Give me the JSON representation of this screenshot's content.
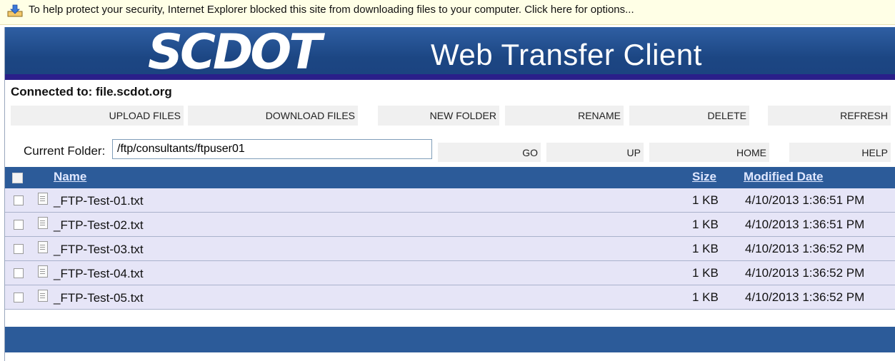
{
  "infobar": {
    "message": "To help protect your security, Internet Explorer blocked this site from downloading files to your computer. Click here for options..."
  },
  "banner": {
    "logo_text": "SCDOT",
    "title": "Web Transfer Client"
  },
  "connection": {
    "label": "Connected to: file.scdot.org"
  },
  "toolbar": {
    "upload": "UPLOAD FILES",
    "download": "DOWNLOAD FILES",
    "new_folder": "NEW FOLDER",
    "rename": "RENAME",
    "delete": "DELETE",
    "refresh": "REFRESH"
  },
  "folder": {
    "label": "Current Folder:",
    "value": "/ftp/consultants/ftpuser01",
    "go": "GO",
    "up": "UP",
    "home": "HOME",
    "help": "HELP"
  },
  "grid": {
    "headers": {
      "name": "Name",
      "size": "Size",
      "date": "Modified Date"
    },
    "rows": [
      {
        "name": "_FTP-Test-01.txt",
        "size": "1 KB",
        "date": "4/10/2013 1:36:51 PM"
      },
      {
        "name": "_FTP-Test-02.txt",
        "size": "1 KB",
        "date": "4/10/2013 1:36:51 PM"
      },
      {
        "name": "_FTP-Test-03.txt",
        "size": "1 KB",
        "date": "4/10/2013 1:36:52 PM"
      },
      {
        "name": "_FTP-Test-04.txt",
        "size": "1 KB",
        "date": "4/10/2013 1:36:52 PM"
      },
      {
        "name": "_FTP-Test-05.txt",
        "size": "1 KB",
        "date": "4/10/2013 1:36:52 PM"
      }
    ]
  },
  "colors": {
    "banner_blue": "#1c4683",
    "grid_header": "#2c5b99",
    "row_bg": "#e6e5f7",
    "infobar_bg": "#ffffe6"
  },
  "icons": {
    "infobar": "download-blocked-icon",
    "file": "text-file-icon"
  }
}
